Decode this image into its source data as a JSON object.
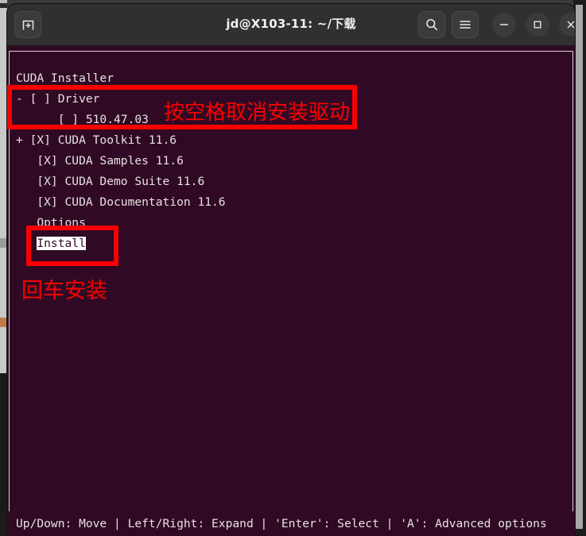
{
  "window": {
    "title": "jd@X103-11: ~/下载",
    "new_tab_icon": "new-tab-icon",
    "search_icon": "search-icon",
    "menu_icon": "hamburger-menu-icon",
    "minimize_icon": "minimize-icon",
    "maximize_icon": "maximize-icon",
    "close_icon": "close-icon",
    "colors": {
      "titlebar_bg": "#303030",
      "terminal_bg": "#300a24",
      "terminal_fg": "#e7e1e3",
      "annotation_red": "#fb0000"
    }
  },
  "terminal": {
    "heading": "CUDA Installer",
    "rows": [
      {
        "indent": 0,
        "text": "CUDA Installer"
      },
      {
        "indent": 0,
        "text": "- [ ] Driver"
      },
      {
        "indent": 0,
        "text": "      [ ] 510.47.03"
      },
      {
        "indent": 0,
        "text": "+ [X] CUDA Toolkit 11.6"
      },
      {
        "indent": 0,
        "text": "   [X] CUDA Samples 11.6"
      },
      {
        "indent": 0,
        "text": "   [X] CUDA Demo Suite 11.6"
      },
      {
        "indent": 0,
        "text": "   [X] CUDA Documentation 11.6"
      },
      {
        "indent": 0,
        "text": "   Options"
      }
    ],
    "selected_item": {
      "prefix": "   ",
      "label": "Install"
    },
    "status_line": "Up/Down: Move | Left/Right: Expand | 'Enter': Select | 'A': Advanced options"
  },
  "annotations": {
    "driver_note": "按空格取消安装驱动",
    "enter_note": "回车安装"
  }
}
